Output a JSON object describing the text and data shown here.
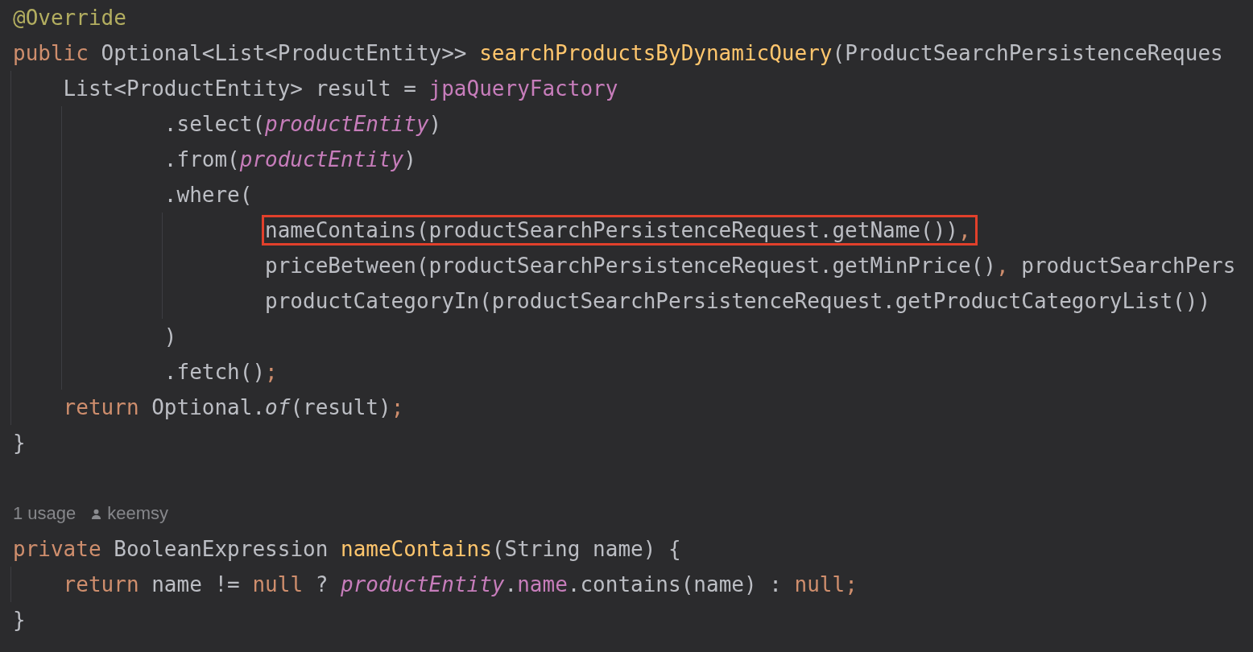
{
  "editor": {
    "lines": [
      {
        "kind": "code",
        "highlighted": false,
        "tokens": [
          {
            "kind": "annotation",
            "text": "@Override"
          }
        ]
      },
      {
        "kind": "opener",
        "highlighted": false,
        "tokens": [
          {
            "kind": "keyword",
            "text": "public"
          },
          {
            "kind": "plain",
            "text": " Optional<List<ProductEntity>> "
          },
          {
            "kind": "method",
            "text": "searchProductsByDynamicQuery"
          },
          {
            "kind": "plain",
            "text": "(ProductSearchPersistenceReques"
          }
        ],
        "children": [
          {
            "kind": "chain",
            "highlighted": false,
            "tokens": [
              {
                "kind": "plain",
                "text": "List<ProductEntity> result = "
              },
              {
                "kind": "field",
                "text": "jpaQueryFactory"
              }
            ],
            "children": [
              {
                "kind": "code",
                "highlighted": false,
                "tokens": [
                  {
                    "kind": "plain",
                    "text": ".select("
                  },
                  {
                    "kind": "static_field",
                    "text": "productEntity"
                  },
                  {
                    "kind": "plain",
                    "text": ")"
                  }
                ]
              },
              {
                "kind": "code",
                "highlighted": false,
                "tokens": [
                  {
                    "kind": "plain",
                    "text": ".from("
                  },
                  {
                    "kind": "static_field",
                    "text": "productEntity"
                  },
                  {
                    "kind": "plain",
                    "text": ")"
                  }
                ]
              },
              {
                "kind": "chain",
                "highlighted": false,
                "tokens": [
                  {
                    "kind": "plain",
                    "text": ".where("
                  }
                ],
                "children": [
                  {
                    "kind": "code",
                    "highlighted": true,
                    "tokens": [
                      {
                        "kind": "plain",
                        "text": "nameContains(productSearchPersistenceRequest.getName())"
                      },
                      {
                        "kind": "punct",
                        "text": ","
                      }
                    ]
                  },
                  {
                    "kind": "code",
                    "highlighted": false,
                    "tokens": [
                      {
                        "kind": "plain",
                        "text": "priceBetween(productSearchPersistenceRequest.getMinPrice()"
                      },
                      {
                        "kind": "punct",
                        "text": ","
                      },
                      {
                        "kind": "plain",
                        "text": " productSearchPers"
                      }
                    ]
                  },
                  {
                    "kind": "code",
                    "highlighted": false,
                    "tokens": [
                      {
                        "kind": "plain",
                        "text": "productCategoryIn(productSearchPersistenceRequest.getProductCategoryList())"
                      }
                    ]
                  }
                ]
              },
              {
                "kind": "code",
                "highlighted": false,
                "tokens": [
                  {
                    "kind": "plain",
                    "text": ")"
                  }
                ]
              },
              {
                "kind": "code",
                "highlighted": false,
                "tokens": [
                  {
                    "kind": "plain",
                    "text": ".fetch()"
                  },
                  {
                    "kind": "punct",
                    "text": ";"
                  }
                ]
              }
            ]
          },
          {
            "kind": "code",
            "highlighted": false,
            "tokens": [
              {
                "kind": "keyword",
                "text": "return"
              },
              {
                "kind": "plain",
                "text": " Optional."
              },
              {
                "kind": "static_method",
                "text": "of"
              },
              {
                "kind": "plain",
                "text": "(result)"
              },
              {
                "kind": "punct",
                "text": ";"
              }
            ]
          }
        ]
      },
      {
        "kind": "code",
        "highlighted": false,
        "tokens": [
          {
            "kind": "plain",
            "text": "}"
          }
        ]
      },
      {
        "kind": "blank"
      },
      {
        "kind": "hint",
        "usage": "1 usage",
        "author": "keemsy"
      },
      {
        "kind": "opener",
        "highlighted": false,
        "tokens": [
          {
            "kind": "keyword",
            "text": "private"
          },
          {
            "kind": "plain",
            "text": " BooleanExpression "
          },
          {
            "kind": "method",
            "text": "nameContains"
          },
          {
            "kind": "plain",
            "text": "(String name) {"
          }
        ],
        "children": [
          {
            "kind": "code",
            "highlighted": false,
            "tokens": [
              {
                "kind": "keyword",
                "text": "return"
              },
              {
                "kind": "plain",
                "text": " name != "
              },
              {
                "kind": "keyword",
                "text": "null"
              },
              {
                "kind": "plain",
                "text": " ? "
              },
              {
                "kind": "static_field",
                "text": "productEntity"
              },
              {
                "kind": "plain",
                "text": "."
              },
              {
                "kind": "field",
                "text": "name"
              },
              {
                "kind": "plain",
                "text": ".contains(name) : "
              },
              {
                "kind": "keyword",
                "text": "null"
              },
              {
                "kind": "punct",
                "text": ";"
              }
            ]
          }
        ]
      },
      {
        "kind": "code",
        "highlighted": false,
        "tokens": [
          {
            "kind": "plain",
            "text": "}"
          }
        ]
      }
    ]
  }
}
